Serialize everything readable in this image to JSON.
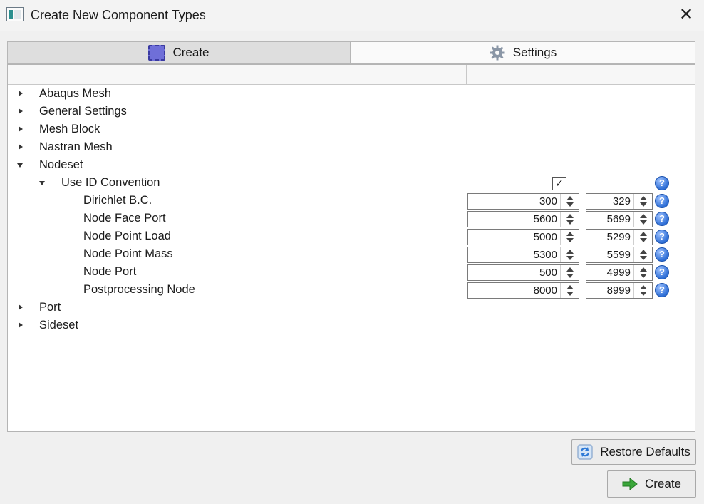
{
  "window": {
    "title": "Create New Component Types"
  },
  "tabs": [
    {
      "label": "Create",
      "icon": "create-icon",
      "active": true
    },
    {
      "label": "Settings",
      "icon": "gear-icon",
      "active": false
    }
  ],
  "tree": {
    "items": [
      {
        "label": "Abaqus Mesh",
        "expanded": false
      },
      {
        "label": "General Settings",
        "expanded": false
      },
      {
        "label": "Mesh Block",
        "expanded": false
      },
      {
        "label": "Nastran Mesh",
        "expanded": false
      },
      {
        "label": "Nodeset",
        "expanded": true
      },
      {
        "label": "Use ID Convention",
        "expanded": true,
        "checked": true,
        "check_glyph": "✓"
      },
      {
        "label": "Dirichlet B.C.",
        "min": "300",
        "max": "329"
      },
      {
        "label": "Node Face Port",
        "min": "5600",
        "max": "5699"
      },
      {
        "label": "Node Point Load",
        "min": "5000",
        "max": "5299"
      },
      {
        "label": "Node Point Mass",
        "min": "5300",
        "max": "5599"
      },
      {
        "label": "Node Port",
        "min": "500",
        "max": "4999"
      },
      {
        "label": "Postprocessing Node",
        "min": "8000",
        "max": "8999"
      },
      {
        "label": "Port",
        "expanded": false
      },
      {
        "label": "Sideset",
        "expanded": false
      }
    ]
  },
  "help_glyph": "?",
  "buttons": {
    "restore_defaults": "Restore Defaults",
    "create": "Create"
  },
  "colors": {
    "help_icon": "#2f6fd6",
    "create_arrow": "#3aa63a",
    "restore_icon": "#2f7ad6"
  }
}
